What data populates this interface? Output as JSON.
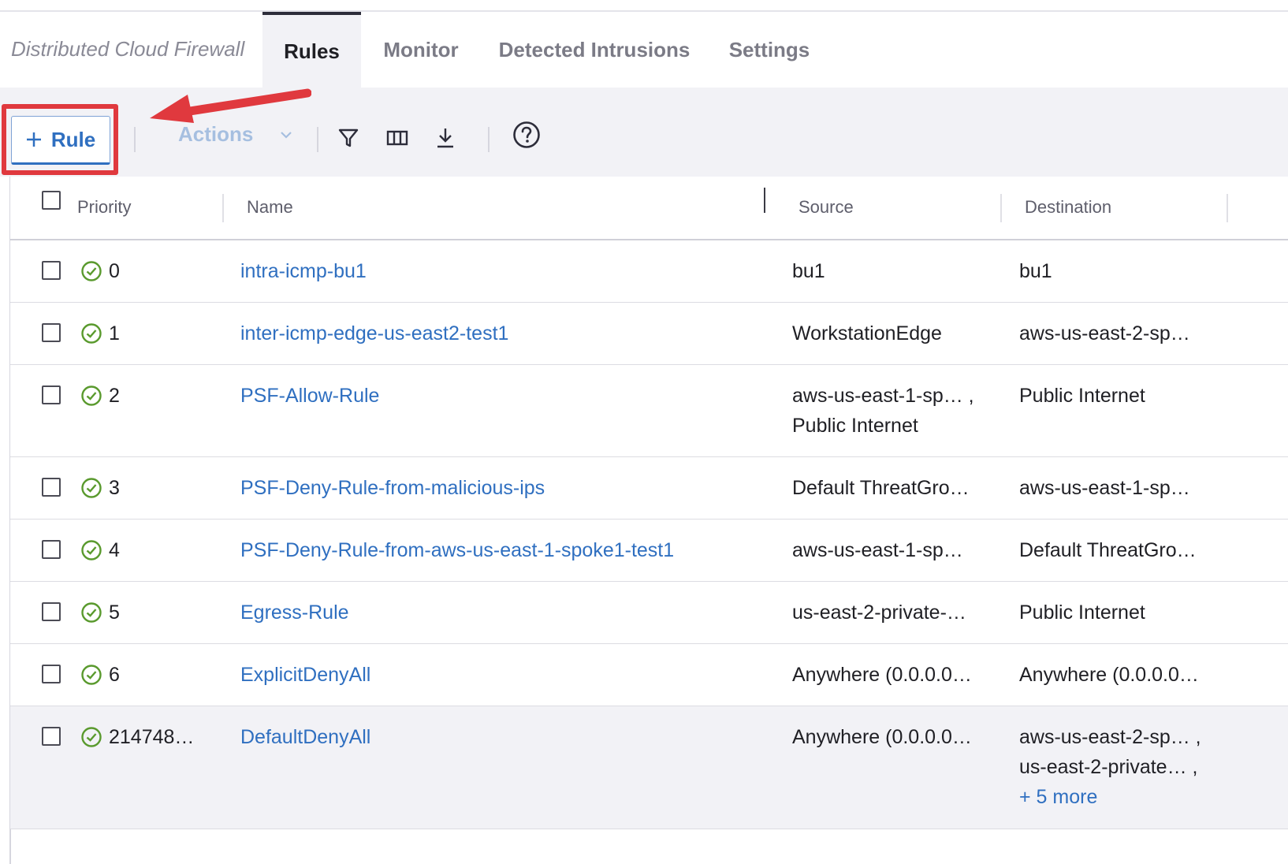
{
  "header": {
    "breadcrumb": "Distributed Cloud Firewall",
    "tabs": [
      {
        "label": "Rules",
        "active": true
      },
      {
        "label": "Monitor",
        "active": false
      },
      {
        "label": "Detected Intrusions",
        "active": false
      },
      {
        "label": "Settings",
        "active": false
      }
    ]
  },
  "toolbar": {
    "add_rule_label": "Rule",
    "add_icon": "plus-icon",
    "actions_label": "Actions",
    "actions_icon": "chevron-down-icon",
    "icons": [
      "filter-icon",
      "columns-icon",
      "download-icon",
      "help-icon"
    ]
  },
  "table": {
    "columns": [
      "Priority",
      "Name",
      "Source",
      "Destination"
    ],
    "rows": [
      {
        "priority": "0",
        "name": "intra-icmp-bu1",
        "source": [
          "bu1"
        ],
        "destination": [
          "bu1"
        ]
      },
      {
        "priority": "1",
        "name": "inter-icmp-edge-us-east2-test1",
        "source": [
          "WorkstationEdge"
        ],
        "destination": [
          "aws-us-east-2-sp…"
        ]
      },
      {
        "priority": "2",
        "name": "PSF-Allow-Rule",
        "source": [
          "aws-us-east-1-sp… ,",
          "Public Internet"
        ],
        "destination": [
          "Public Internet"
        ]
      },
      {
        "priority": "3",
        "name": "PSF-Deny-Rule-from-malicious-ips",
        "source": [
          "Default ThreatGro…"
        ],
        "destination": [
          "aws-us-east-1-sp…"
        ]
      },
      {
        "priority": "4",
        "name": "PSF-Deny-Rule-from-aws-us-east-1-spoke1-test1",
        "source": [
          "aws-us-east-1-sp…"
        ],
        "destination": [
          "Default ThreatGro…"
        ]
      },
      {
        "priority": "5",
        "name": "Egress-Rule",
        "source": [
          "us-east-2-private-…"
        ],
        "destination": [
          "Public Internet"
        ]
      },
      {
        "priority": "6",
        "name": "ExplicitDenyAll",
        "source": [
          "Anywhere (0.0.0.0…"
        ],
        "destination": [
          "Anywhere (0.0.0.0…"
        ]
      },
      {
        "priority": "214748…",
        "name": "DefaultDenyAll",
        "source": [
          "Anywhere (0.0.0.0…"
        ],
        "destination": [
          "aws-us-east-2-sp… ,",
          "us-east-2-private… ,"
        ],
        "destination_more": "+ 5 more"
      }
    ]
  },
  "colors": {
    "accent": "#2f6fc0",
    "status_ok": "#5a9a2e",
    "annotation_red": "#e0393e",
    "toolbar_bg": "#f2f2f6"
  },
  "row_status_icon": "check-circle-icon"
}
